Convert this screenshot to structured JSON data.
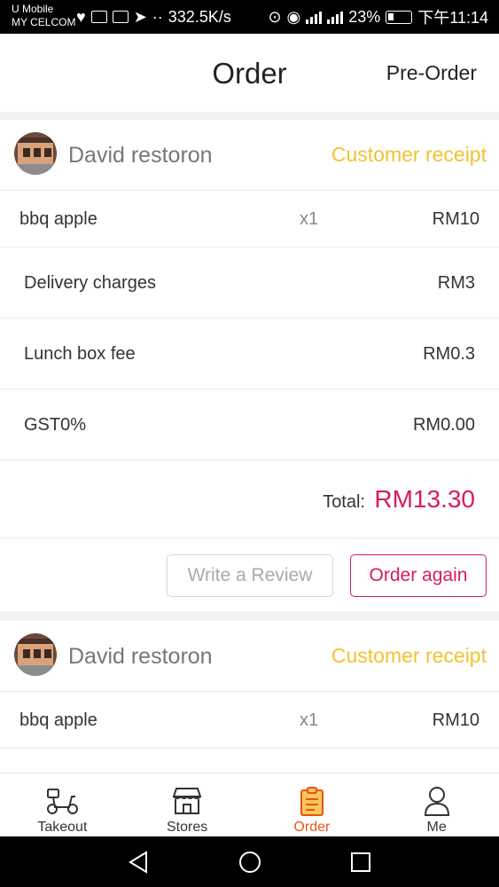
{
  "status_bar": {
    "carrier_line1": "U Mobile",
    "carrier_line2": "MY CELCOM",
    "net_speed": "332.5K/s",
    "battery": "23%",
    "time": "下午11:14"
  },
  "header": {
    "title": "Order",
    "pre_order": "Pre-Order"
  },
  "orders": [
    {
      "store": "David restoron",
      "receipt_link": "Customer receipt",
      "items": [
        {
          "name": "bbq apple",
          "qty": "x1",
          "price": "RM10"
        }
      ],
      "fees": [
        {
          "name": "Delivery charges",
          "price": "RM3"
        },
        {
          "name": "Lunch box fee",
          "price": "RM0.3"
        },
        {
          "name": "GST0%",
          "price": "RM0.00"
        }
      ],
      "total_label": "Total:",
      "total": "RM13.30",
      "review_button": "Write a Review",
      "again_button": "Order again"
    },
    {
      "store": "David restoron",
      "receipt_link": "Customer receipt",
      "items": [
        {
          "name": "bbq apple",
          "qty": "x1",
          "price": "RM10"
        }
      ]
    }
  ],
  "tabbar": {
    "items": [
      {
        "label": "Takeout",
        "icon": "scooter-icon"
      },
      {
        "label": "Stores",
        "icon": "store-icon"
      },
      {
        "label": "Order",
        "icon": "clipboard-icon",
        "active": true
      },
      {
        "label": "Me",
        "icon": "person-icon"
      }
    ],
    "active_color": "#e8531a"
  },
  "colors": {
    "accent": "#d81b60",
    "receipt_link": "#f2c230"
  }
}
